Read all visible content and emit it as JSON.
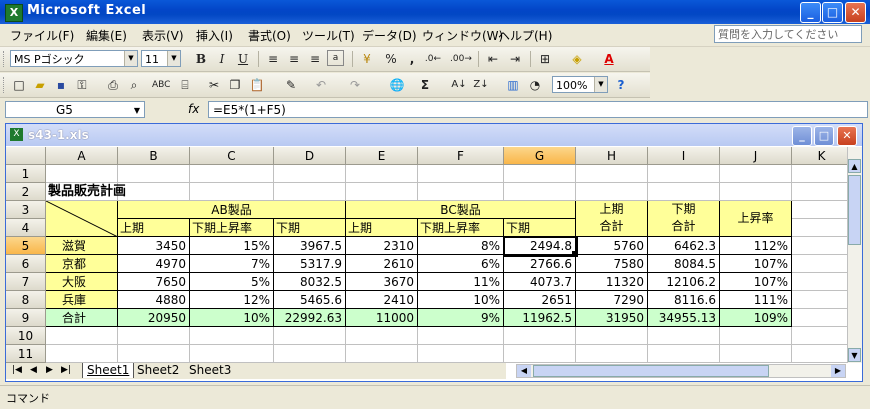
{
  "app": {
    "title": "Microsoft Excel",
    "icon": "excel-icon"
  },
  "menu": {
    "items": [
      "ファイル(F)",
      "編集(E)",
      "表示(V)",
      "挿入(I)",
      "書式(O)",
      "ツール(T)",
      "データ(D)",
      "ウィンドウ(W)",
      "ヘルプ(H)"
    ],
    "ask_placeholder": "質問を入力してください"
  },
  "format_toolbar": {
    "font": "MS Pゴシック",
    "size": "11"
  },
  "std_toolbar": {
    "zoom": "100%"
  },
  "formula_bar": {
    "name_box": "G5",
    "fx": "fx",
    "formula": "=E5*(1+F5)"
  },
  "workbook": {
    "title": "s43-1.xls"
  },
  "columns": [
    "A",
    "B",
    "C",
    "D",
    "E",
    "F",
    "G",
    "H",
    "I",
    "J",
    "K"
  ],
  "rows": [
    "1",
    "2",
    "3",
    "4",
    "5",
    "6",
    "7",
    "8",
    "9",
    "10",
    "11"
  ],
  "sheet": {
    "title": "製品販売計画",
    "ab_header": "AB製品",
    "bc_header": "BC製品",
    "sub_headers": [
      "上期",
      "下期上昇率",
      "下期",
      "上期",
      "下期上昇率",
      "下期"
    ],
    "h_header": [
      "上期",
      "合計"
    ],
    "i_header": [
      "下期",
      "合計"
    ],
    "j_header": "上昇率",
    "data_rows": [
      [
        "滋賀",
        "3450",
        "15%",
        "3967.5",
        "2310",
        "8%",
        "2494.8",
        "5760",
        "6462.3",
        "112%"
      ],
      [
        "京都",
        "4970",
        "7%",
        "5317.9",
        "2610",
        "6%",
        "2766.6",
        "7580",
        "8084.5",
        "107%"
      ],
      [
        "大阪",
        "7650",
        "5%",
        "8032.5",
        "3670",
        "11%",
        "4073.7",
        "11320",
        "12106.2",
        "107%"
      ],
      [
        "兵庫",
        "4880",
        "12%",
        "5465.6",
        "2410",
        "10%",
        "2651",
        "7290",
        "8116.6",
        "111%"
      ],
      [
        "合計",
        "20950",
        "10%",
        "22992.63",
        "11000",
        "9%",
        "11962.5",
        "31950",
        "34955.13",
        "109%"
      ]
    ]
  },
  "tabs": [
    "Sheet1",
    "Sheet2",
    "Sheet3"
  ],
  "status": {
    "text": "コマンド"
  }
}
